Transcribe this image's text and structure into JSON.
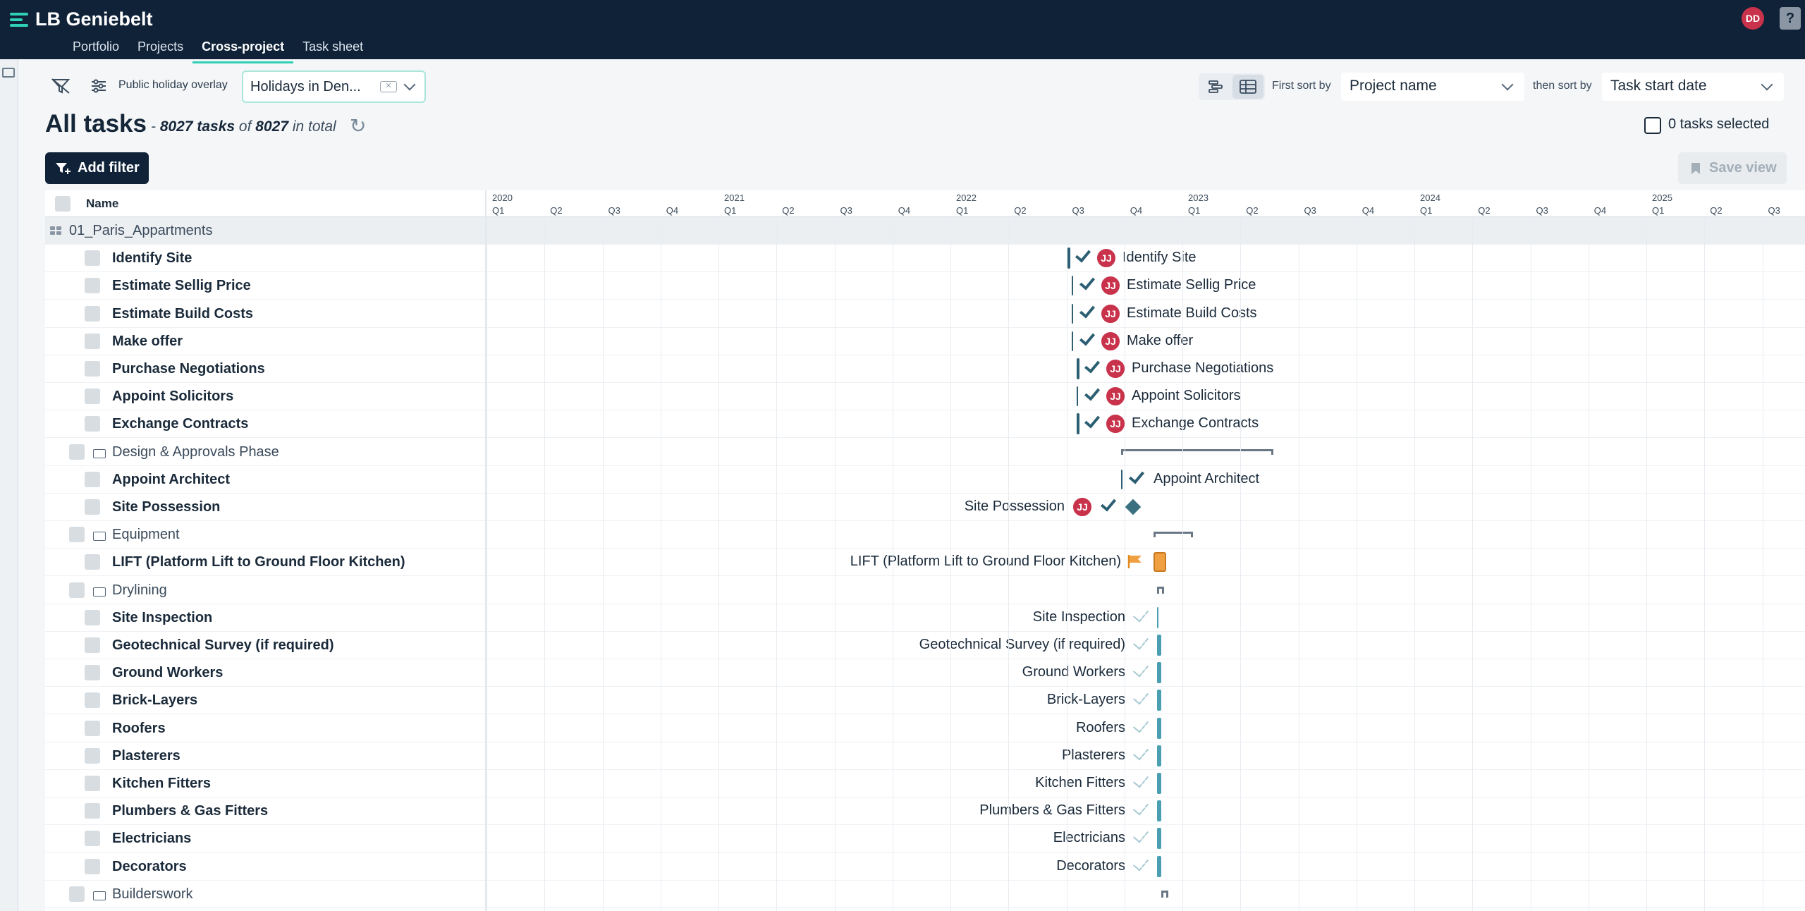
{
  "app": {
    "name": "LB Geniebelt",
    "user_initials": "DD",
    "help": "?"
  },
  "nav": [
    "Portfolio",
    "Projects",
    "Cross-project",
    "Task sheet"
  ],
  "toolbar": {
    "holiday_label": "Public holiday overlay",
    "holiday_value": "Holidays in Den...",
    "first_sort_label": "First sort by",
    "first_sort_value": "Project name",
    "then_sort_label": "then sort by",
    "then_sort_value": "Task start date"
  },
  "header": {
    "title": "All tasks",
    "count_prefix": "- ",
    "shown": "8027 tasks",
    "of": " of ",
    "total": "8027",
    "suffix": " in total",
    "selected": "0 tasks selected",
    "add_filter": "Add filter",
    "save_view": "Save view"
  },
  "grid": {
    "name_col": "Name",
    "years": [
      "2020",
      "2021",
      "2022",
      "2023",
      "2024",
      "2025"
    ],
    "quarters": [
      "Q1",
      "Q2",
      "Q3",
      "Q4"
    ],
    "rows": [
      {
        "type": "project",
        "name": "01_Paris_Appartments"
      },
      {
        "type": "task",
        "name": "Identify Site"
      },
      {
        "type": "task",
        "name": "Estimate Sellig Price"
      },
      {
        "type": "task",
        "name": "Estimate Build Costs"
      },
      {
        "type": "task",
        "name": "Make offer"
      },
      {
        "type": "task",
        "name": "Purchase Negotiations"
      },
      {
        "type": "task",
        "name": "Appoint Solicitors"
      },
      {
        "type": "task",
        "name": "Exchange Contracts"
      },
      {
        "type": "phase",
        "name": "Design & Approvals Phase"
      },
      {
        "type": "task",
        "name": "Appoint Architect"
      },
      {
        "type": "task",
        "name": "Site Possession"
      },
      {
        "type": "phase",
        "name": "Equipment"
      },
      {
        "type": "task",
        "name": "LIFT (Platform Lift to Ground Floor Kitchen)"
      },
      {
        "type": "phase",
        "name": "Drylining"
      },
      {
        "type": "task",
        "name": "Site Inspection"
      },
      {
        "type": "task",
        "name": "Geotechnical Survey (if required)"
      },
      {
        "type": "task",
        "name": "Ground Workers"
      },
      {
        "type": "task",
        "name": "Brick-Layers"
      },
      {
        "type": "task",
        "name": "Roofers"
      },
      {
        "type": "task",
        "name": "Plasterers"
      },
      {
        "type": "task",
        "name": "Kitchen Fitters"
      },
      {
        "type": "task",
        "name": "Plumbers & Gas Fitters"
      },
      {
        "type": "task",
        "name": "Electricians"
      },
      {
        "type": "task",
        "name": "Decorators"
      },
      {
        "type": "phase",
        "name": "Builderswork"
      }
    ],
    "assignee_initials": "JJ"
  }
}
